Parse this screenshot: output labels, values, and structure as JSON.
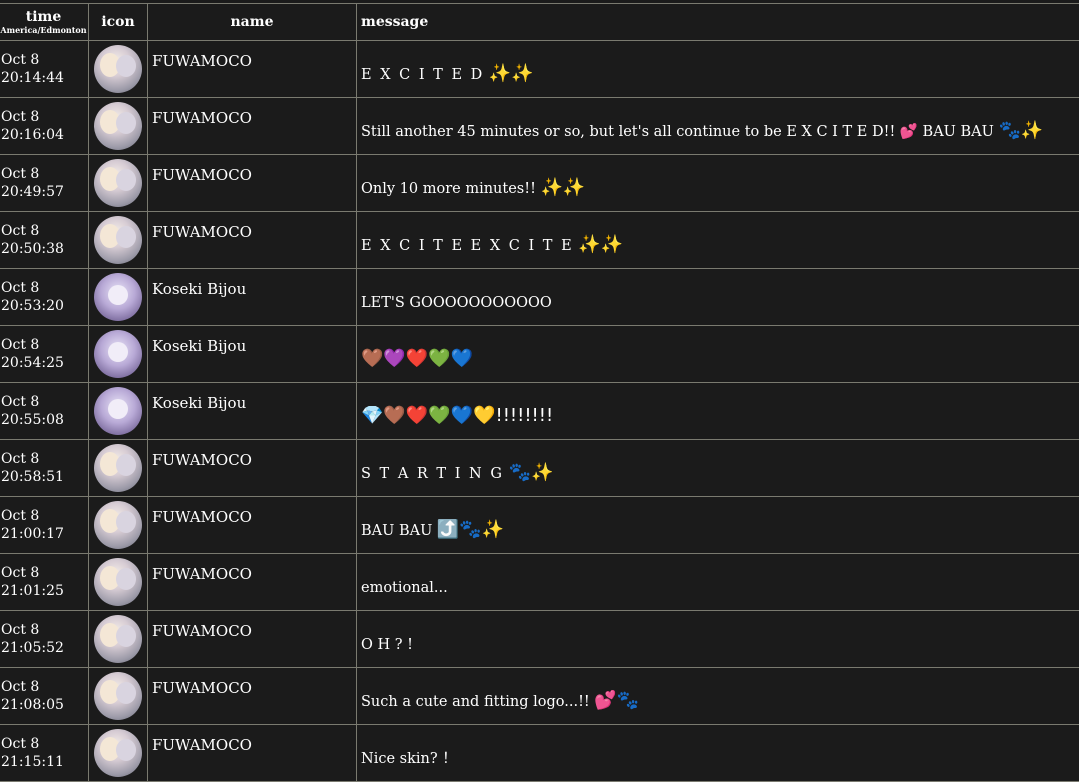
{
  "header": {
    "time_label": "time",
    "timezone": "America/Edmonton",
    "icon_label": "icon",
    "name_label": "name",
    "message_label": "message"
  },
  "rows": [
    {
      "date": "Oct 8",
      "time": "20:14:44",
      "name": "FUWAMOCO",
      "avatar": "fuwamoco",
      "message": "E X C I T E D",
      "emoji": "✨✨",
      "spaced": true
    },
    {
      "date": "Oct 8",
      "time": "20:16:04",
      "name": "FUWAMOCO",
      "avatar": "fuwamoco",
      "message": "Still another 45 minutes or so, but let's all continue to be E X C I T E D!! 💕 BAU BAU",
      "emoji": "🐾✨",
      "spaced": false
    },
    {
      "date": "Oct 8",
      "time": "20:49:57",
      "name": "FUWAMOCO",
      "avatar": "fuwamoco",
      "message": "Only 10 more minutes!!",
      "emoji": "✨✨",
      "spaced": false
    },
    {
      "date": "Oct 8",
      "time": "20:50:38",
      "name": "FUWAMOCO",
      "avatar": "fuwamoco",
      "message": "E X C I T E E X C I T E",
      "emoji": "✨✨",
      "spaced": true
    },
    {
      "date": "Oct 8",
      "time": "20:53:20",
      "name": "Koseki Bijou",
      "avatar": "bijou",
      "message": "LET'S GOOOOOOOOOOO",
      "emoji": "",
      "spaced": false
    },
    {
      "date": "Oct 8",
      "time": "20:54:25",
      "name": "Koseki Bijou",
      "avatar": "bijou",
      "message": "",
      "emoji": "🤎💜❤️💚💙",
      "spaced": false
    },
    {
      "date": "Oct 8",
      "time": "20:55:08",
      "name": "Koseki Bijou",
      "avatar": "bijou",
      "message": "",
      "emoji": "💎🤎❤️💚💙💛!!!!!!!!",
      "spaced": false
    },
    {
      "date": "Oct 8",
      "time": "20:58:51",
      "name": "FUWAMOCO",
      "avatar": "fuwamoco",
      "message": "S T A R T I N G",
      "emoji": "🐾✨",
      "spaced": true
    },
    {
      "date": "Oct 8",
      "time": "21:00:17",
      "name": "FUWAMOCO",
      "avatar": "fuwamoco",
      "message": "BAU BAU",
      "emoji": "⤴️🐾✨",
      "spaced": false
    },
    {
      "date": "Oct 8",
      "time": "21:01:25",
      "name": "FUWAMOCO",
      "avatar": "fuwamoco",
      "message": "emotional...",
      "emoji": "",
      "spaced": false
    },
    {
      "date": "Oct 8",
      "time": "21:05:52",
      "name": "FUWAMOCO",
      "avatar": "fuwamoco",
      "message": "O H ? !",
      "emoji": "",
      "spaced": false
    },
    {
      "date": "Oct 8",
      "time": "21:08:05",
      "name": "FUWAMOCO",
      "avatar": "fuwamoco",
      "message": "Such a cute and fitting logo...!!",
      "emoji": "💕🐾",
      "spaced": false
    },
    {
      "date": "Oct 8",
      "time": "21:15:11",
      "name": "FUWAMOCO",
      "avatar": "fuwamoco",
      "message": "Nice skin? ！",
      "emoji": "",
      "spaced": false
    }
  ]
}
